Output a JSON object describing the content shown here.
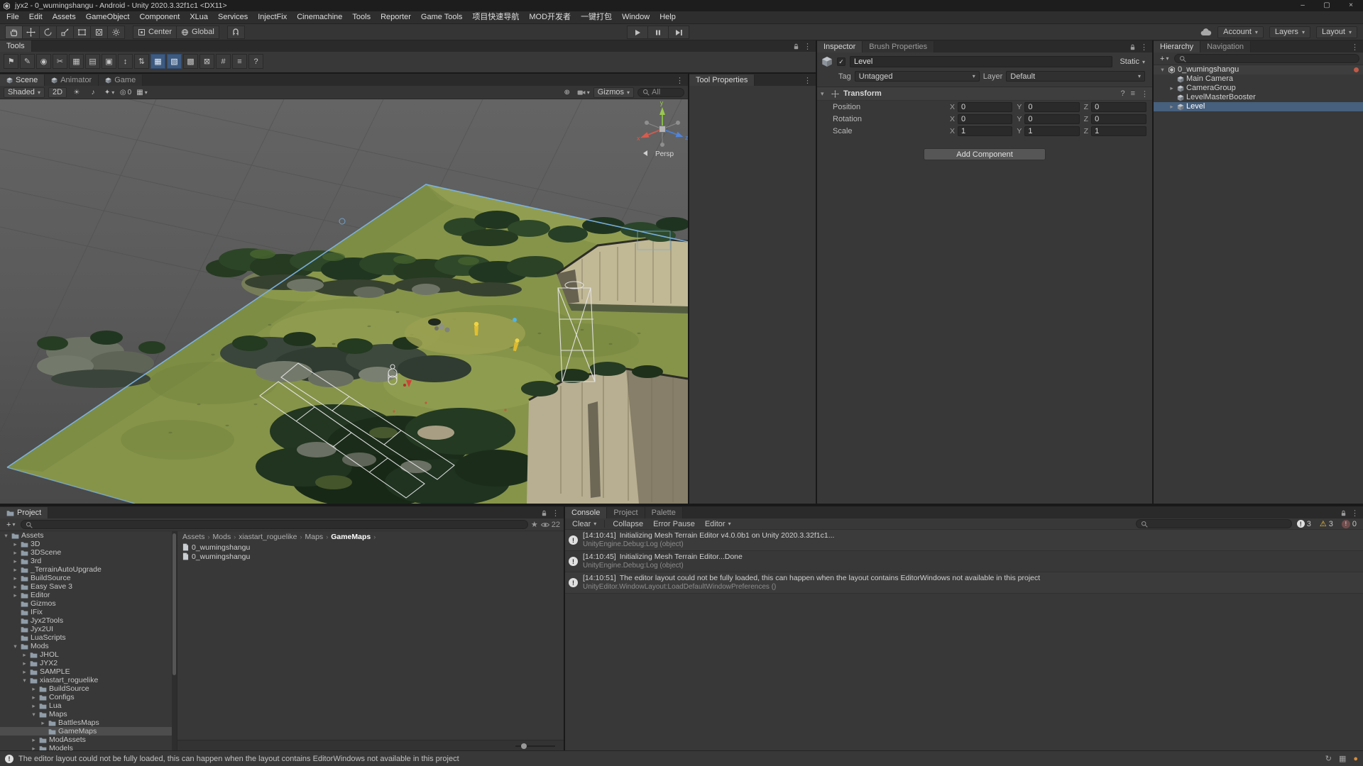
{
  "window": {
    "title": "jyx2 - 0_wumingshangu - Android - Unity 2020.3.32f1c1 <DX11>",
    "controls": {
      "minimize": "–",
      "maximize": "▢",
      "close": "×"
    }
  },
  "icons": {
    "caret": "▾",
    "kebab": "⋮",
    "plus": "+",
    "crumb_sep": "›",
    "light": "☀",
    "audio": "♪",
    "fx": "✦",
    "visibility": "◎",
    "grid": "▦",
    "handle": "⊕",
    "camera": "⊙",
    "check": "✓",
    "help": "?",
    "presets": "≡",
    "star": "★",
    "info": "!",
    "error": "!",
    "warning": "⚠",
    "status": "!"
  },
  "colors": {
    "selection_blue": "#46607e",
    "tab_active": "#3c3c3c",
    "grass": "#86944a",
    "axis_x": "#d65c4e",
    "axis_y": "#9ac84f",
    "axis_z": "#5285da",
    "warning_yellow": "#f3c73c"
  },
  "menu_bar": {
    "items": [
      "File",
      "Edit",
      "Assets",
      "GameObject",
      "Component",
      "XLua",
      "Services",
      "InjectFix",
      "Cinemachine",
      "Tools",
      "Reporter",
      "Game Tools",
      "项目快速导航",
      "MOD开发者",
      "一键打包",
      "Window",
      "Help"
    ]
  },
  "toolbar": {
    "tool_icons": [
      "view-hand-tool",
      "move-tool",
      "rotate-tool",
      "scale-tool",
      "rect-tool",
      "transform-tool",
      "custom-editor-tool"
    ],
    "pivot": "Center",
    "space": "Global",
    "account": "Account",
    "layers": "Layers",
    "layout": "Layout"
  },
  "tools_panel": {
    "tab": "Tools",
    "buttons": [
      {
        "name": "flag-tool-icon",
        "glyph": "⚑",
        "active": false
      },
      {
        "name": "draw-tool-icon",
        "glyph": "✎",
        "active": false
      },
      {
        "name": "picker-tool-icon",
        "glyph": "◉",
        "active": false
      },
      {
        "name": "cut-tool-icon",
        "glyph": "✂",
        "active": false
      },
      {
        "name": "grid-tool-icon",
        "glyph": "▦",
        "active": false
      },
      {
        "name": "terrain-tool-icon",
        "glyph": "▤",
        "active": false
      },
      {
        "name": "stamp-tool-icon",
        "glyph": "▣",
        "active": false
      },
      {
        "name": "raise-lower-tool-icon",
        "glyph": "↕",
        "active": false
      },
      {
        "name": "swap-tool-icon",
        "glyph": "⇅",
        "active": false
      },
      {
        "name": "mesh-grid-tool-icon",
        "glyph": "▦",
        "active": true
      },
      {
        "name": "wire-grid-tool-icon",
        "glyph": "▧",
        "active": true
      },
      {
        "name": "block-tool-icon",
        "glyph": "▩",
        "active": false
      },
      {
        "name": "erase-tool-icon",
        "glyph": "⊠",
        "active": false
      },
      {
        "name": "hash-tool-icon",
        "glyph": "#",
        "active": false
      },
      {
        "name": "layers-tool-icon",
        "glyph": "≡",
        "active": false
      },
      {
        "name": "help-icon",
        "glyph": "?",
        "active": false
      }
    ]
  },
  "scene_view": {
    "tabs": [
      {
        "label": "Scene",
        "active": true
      },
      {
        "label": "Animator",
        "active": false
      },
      {
        "label": "Game",
        "active": false
      }
    ],
    "shading": "Shaded",
    "toggle_2d": "2D",
    "visibility_count": "0",
    "gizmos": "Gizmos",
    "search_text": "All",
    "persp": "Persp",
    "axis": {
      "x": "x",
      "y": "y",
      "z": "z"
    }
  },
  "tool_properties": {
    "tab": "Tool Properties"
  },
  "inspector": {
    "tabs": [
      {
        "label": "Inspector",
        "active": true
      },
      {
        "label": "Brush Properties",
        "active": false
      }
    ],
    "object_name": "Level",
    "static_label": "Static",
    "tag_label": "Tag",
    "tag_value": "Untagged",
    "layer_label": "Layer",
    "layer_value": "Default",
    "component_title": "Transform",
    "transform_rows": [
      {
        "label": "Position",
        "fields": [
          {
            "axis": "X",
            "value": "0"
          },
          {
            "axis": "Y",
            "value": "0"
          },
          {
            "axis": "Z",
            "value": "0"
          }
        ]
      },
      {
        "label": "Rotation",
        "fields": [
          {
            "axis": "X",
            "value": "0"
          },
          {
            "axis": "Y",
            "value": "0"
          },
          {
            "axis": "Z",
            "value": "0"
          }
        ]
      },
      {
        "label": "Scale",
        "fields": [
          {
            "axis": "X",
            "value": "1"
          },
          {
            "axis": "Y",
            "value": "1"
          },
          {
            "axis": "Z",
            "value": "1"
          }
        ]
      }
    ],
    "add_component": "Add Component"
  },
  "hierarchy": {
    "tabs": [
      {
        "label": "Hierarchy",
        "active": true
      },
      {
        "label": "Navigation",
        "active": false
      }
    ],
    "search_text": "",
    "scene_name": "0_wumingshangu",
    "items": [
      {
        "label": "Main Camera",
        "arrow": "",
        "indent": 1,
        "selected": false
      },
      {
        "label": "CameraGroup",
        "arrow": "▸",
        "indent": 1,
        "selected": false
      },
      {
        "label": "LevelMasterBooster",
        "arrow": "",
        "indent": 1,
        "selected": false
      },
      {
        "label": "Level",
        "arrow": "▸",
        "indent": 1,
        "selected": true
      }
    ]
  },
  "project": {
    "tabs": [
      {
        "label": "Project",
        "active": true
      }
    ],
    "search_text": "",
    "hidden_count": "22",
    "tree": [
      {
        "label": "Assets",
        "indent": 0,
        "arrow": "▾",
        "selected": false
      },
      {
        "label": "3D",
        "indent": 1,
        "arrow": "▸",
        "selected": false
      },
      {
        "label": "3DScene",
        "indent": 1,
        "arrow": "▸",
        "selected": false
      },
      {
        "label": "3rd",
        "indent": 1,
        "arrow": "▸",
        "selected": false
      },
      {
        "label": "_TerrainAutoUpgrade",
        "indent": 1,
        "arrow": "▸",
        "selected": false
      },
      {
        "label": "BuildSource",
        "indent": 1,
        "arrow": "▸",
        "selected": false
      },
      {
        "label": "Easy Save 3",
        "indent": 1,
        "arrow": "▸",
        "selected": false
      },
      {
        "label": "Editor",
        "indent": 1,
        "arrow": "▸",
        "selected": false
      },
      {
        "label": "Gizmos",
        "indent": 1,
        "arrow": "",
        "selected": false
      },
      {
        "label": "IFix",
        "indent": 1,
        "arrow": "",
        "selected": false
      },
      {
        "label": "Jyx2Tools",
        "indent": 1,
        "arrow": "",
        "selected": false
      },
      {
        "label": "Jyx2UI",
        "indent": 1,
        "arrow": "",
        "selected": false
      },
      {
        "label": "LuaScripts",
        "indent": 1,
        "arrow": "",
        "selected": false
      },
      {
        "label": "Mods",
        "indent": 1,
        "arrow": "▾",
        "selected": false
      },
      {
        "label": "JHOL",
        "indent": 2,
        "arrow": "▸",
        "selected": false
      },
      {
        "label": "JYX2",
        "indent": 2,
        "arrow": "▸",
        "selected": false
      },
      {
        "label": "SAMPLE",
        "indent": 2,
        "arrow": "▸",
        "selected": false
      },
      {
        "label": "xiastart_roguelike",
        "indent": 2,
        "arrow": "▾",
        "selected": false
      },
      {
        "label": "BuildSource",
        "indent": 3,
        "arrow": "▸",
        "selected": false
      },
      {
        "label": "Configs",
        "indent": 3,
        "arrow": "▸",
        "selected": false
      },
      {
        "label": "Lua",
        "indent": 3,
        "arrow": "▸",
        "selected": false
      },
      {
        "label": "Maps",
        "indent": 3,
        "arrow": "▾",
        "selected": false
      },
      {
        "label": "BattlesMaps",
        "indent": 4,
        "arrow": "▸",
        "selected": false
      },
      {
        "label": "GameMaps",
        "indent": 4,
        "arrow": "",
        "selected": true
      },
      {
        "label": "ModAssets",
        "indent": 3,
        "arrow": "▸",
        "selected": false
      },
      {
        "label": "Models",
        "indent": 3,
        "arrow": "▸",
        "selected": false
      }
    ],
    "breadcrumb": [
      {
        "label": "Assets",
        "current": false
      },
      {
        "label": "Mods",
        "current": false
      },
      {
        "label": "xiastart_roguelike",
        "current": false
      },
      {
        "label": "Maps",
        "current": false
      },
      {
        "label": "GameMaps",
        "current": true
      }
    ],
    "items": [
      {
        "label": "0_wumingshangu"
      },
      {
        "label": "0_wumingshangu"
      }
    ]
  },
  "console": {
    "tabs": [
      {
        "label": "Console",
        "active": true
      },
      {
        "label": "Project",
        "active": false
      },
      {
        "label": "Palette",
        "active": false
      }
    ],
    "buttons": {
      "clear": "Clear",
      "collapse": "Collapse",
      "error_pause": "Error Pause",
      "editor": "Editor"
    },
    "search_text": "",
    "counts": {
      "logs": "3",
      "warnings": "3",
      "errors": "0"
    },
    "entries": [
      {
        "time": "[14:10:41]",
        "message": "Initializing Mesh Terrain Editor v4.0.0b1 on Unity 2020.3.32f1c1...",
        "detail": "UnityEngine.Debug:Log (object)"
      },
      {
        "time": "[14:10:45]",
        "message": "Initializing Mesh Terrain Editor...Done",
        "detail": "UnityEngine.Debug:Log (object)"
      },
      {
        "time": "[14:10:51]",
        "message": "The editor layout could not be fully loaded, this can happen when the layout contains EditorWindows not available in this project",
        "detail": "UnityEditor.WindowLayout:LoadDefaultWindowPreferences ()"
      }
    ]
  },
  "status_bar": {
    "message": "The editor layout could not be fully loaded, this can happen when the layout contains EditorWindows not available in this project"
  }
}
